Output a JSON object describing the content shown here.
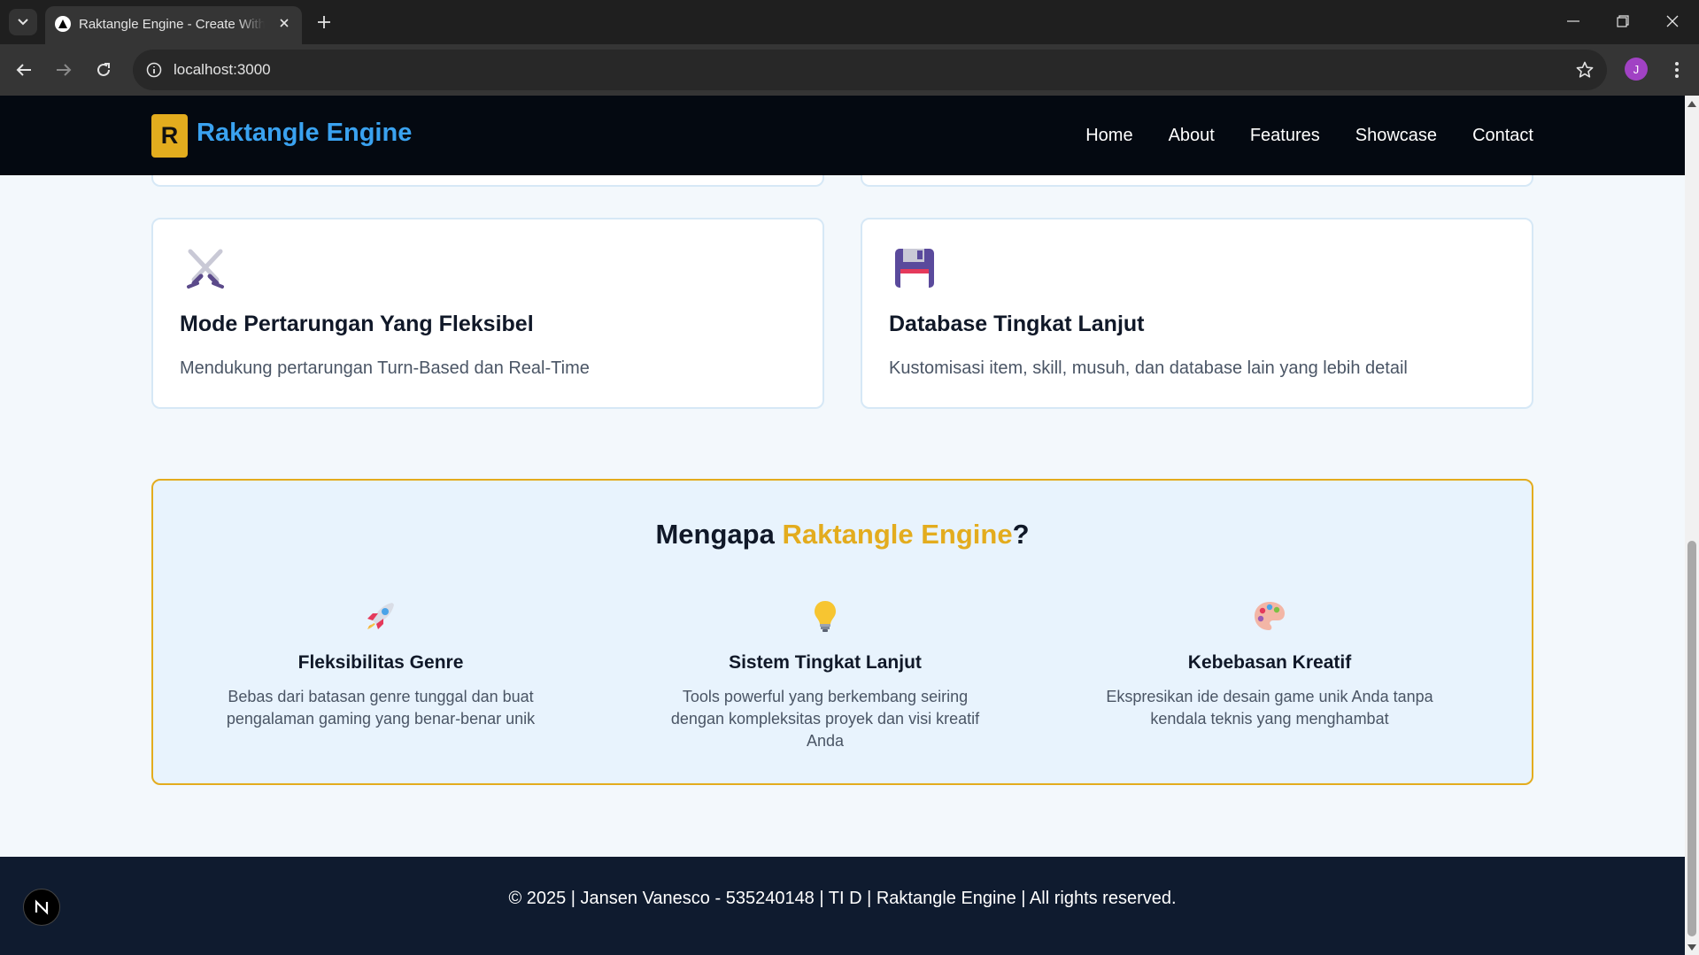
{
  "browser": {
    "tab_title": "Raktangle Engine - Create With Raktangle",
    "url": "localhost:3000",
    "profile_initial": "J",
    "icons": [
      "tab-search-icon",
      "favicon",
      "close-icon",
      "plus-icon",
      "minimize-icon",
      "restore-icon",
      "close-window-icon",
      "back-icon",
      "forward-icon",
      "reload-icon",
      "site-info-icon",
      "star-icon",
      "kebab-menu-icon"
    ]
  },
  "header": {
    "logo_letter": "R",
    "brand": "Raktangle Engine",
    "brand_color": "#3aa2f0",
    "accent_color": "#e3ac1e",
    "nav": [
      "Home",
      "About",
      "Features",
      "Showcase",
      "Contact"
    ]
  },
  "features": [
    {
      "icon": "crossed-swords-icon",
      "title": "Mode Pertarungan Yang Fleksibel",
      "desc": "Mendukung pertarungan Turn-Based dan Real-Time"
    },
    {
      "icon": "floppy-disk-icon",
      "title": "Database Tingkat Lanjut",
      "desc": "Kustomisasi item, skill, musuh, dan database lain yang lebih detail"
    }
  ],
  "why": {
    "title_prefix": "Mengapa ",
    "title_accent": "Raktangle Engine",
    "title_suffix": "?",
    "items": [
      {
        "icon": "rocket-icon",
        "title": "Fleksibilitas Genre",
        "desc": "Bebas dari batasan genre tunggal dan buat pengalaman gaming yang benar-benar unik"
      },
      {
        "icon": "light-bulb-icon",
        "title": "Sistem Tingkat Lanjut",
        "desc": "Tools powerful yang berkembang seiring dengan kompleksitas proyek dan visi kreatif Anda"
      },
      {
        "icon": "palette-icon",
        "title": "Kebebasan Kreatif",
        "desc": "Ekspresikan ide desain game unik Anda tanpa kendala teknis yang menghambat"
      }
    ]
  },
  "footer": {
    "text": "© 2025 | Jansen Vanesco - 535240148 | TI D | Raktangle Engine | All rights reserved.",
    "dev_badge": "N"
  }
}
